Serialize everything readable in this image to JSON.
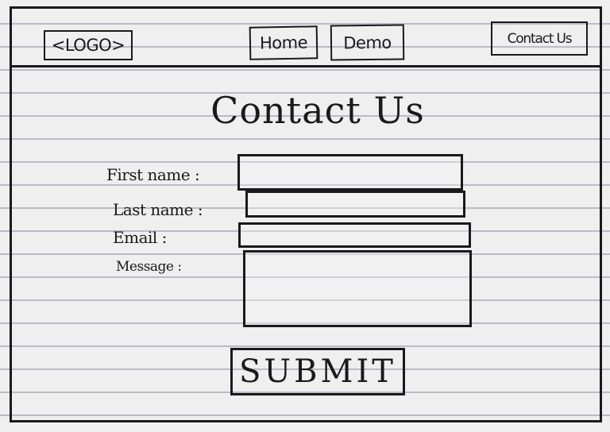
{
  "header": {
    "logo": "<LOGO>",
    "nav": {
      "home": "Home",
      "demo": "Demo",
      "contact": "Contact Us"
    }
  },
  "main": {
    "title": "Contact Us",
    "labels": {
      "first_name": "First name :",
      "last_name": "Last name :",
      "email": "Email   :",
      "message": "Message :"
    },
    "submit_label": "SUBMIT"
  }
}
